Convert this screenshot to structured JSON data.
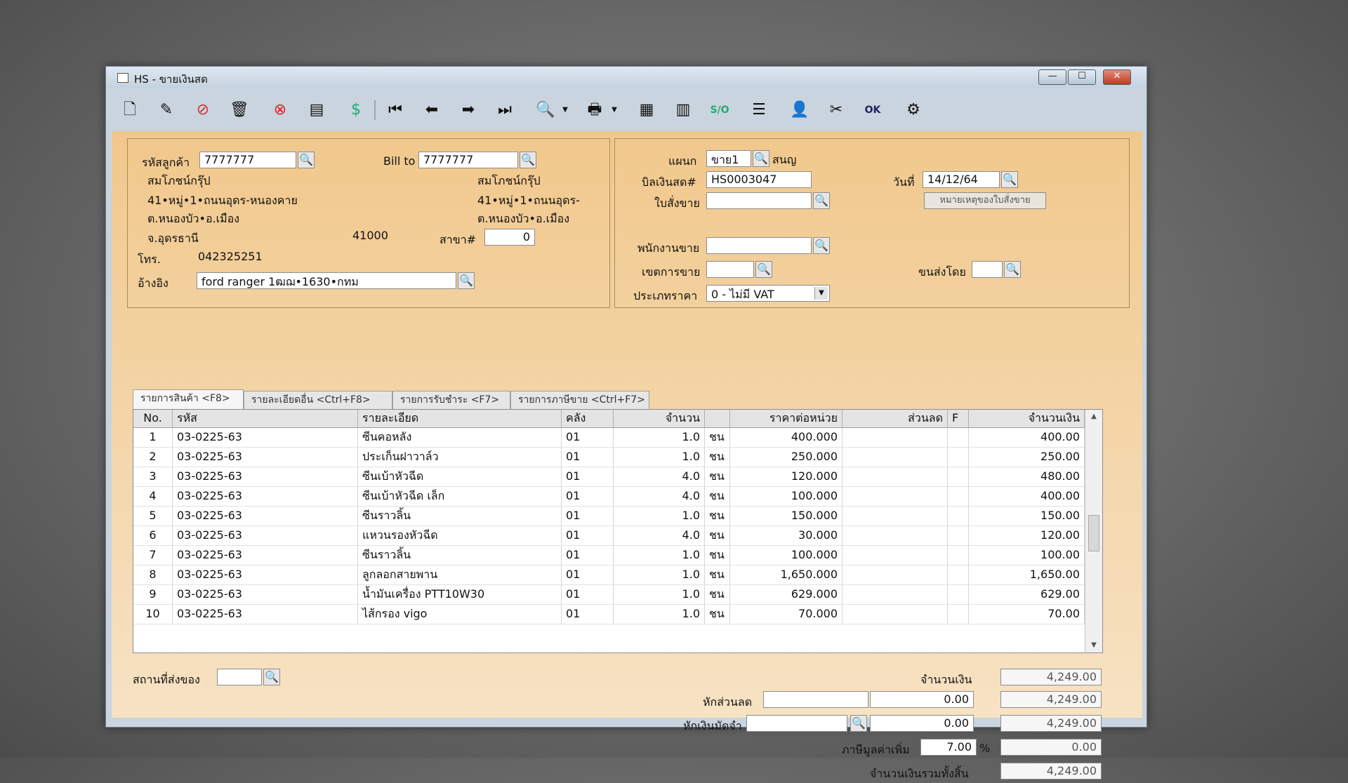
{
  "window": {
    "title": "HS - ขายเงินสด",
    "min": "—",
    "max": "☐",
    "close": "✕"
  },
  "toolbar_icons": [
    "new-document-icon",
    "edit-icon",
    "void-icon",
    "delete-bin-icon",
    "cancel-icon",
    "save-icon",
    "money-icon",
    "first-record-icon",
    "previous-record-icon",
    "next-record-icon",
    "last-record-icon",
    "search-icon",
    "print-icon",
    "calculator-icon",
    "report-icon",
    "svg-export-icon",
    "list-icon",
    "approve-user-icon",
    "tools-icon",
    "ok-icon",
    "settings-icon"
  ],
  "customer": {
    "code_label": "รหัสลูกค้า",
    "code": "7777777",
    "name": "สมโภชน์กรุ๊ป",
    "addr1": "41•หมู่•1•ถนนอุดร-หนองคาย",
    "addr2": "ต.หนองบัว•อ.เมือง",
    "addr3": "จ.อุดรธานี",
    "zip": "41000",
    "phone_label": "โทร.",
    "phone": "042325251",
    "ref_label": "อ้างอิง",
    "ref": "ford ranger 1ฒฌ•1630•กทม"
  },
  "billto": {
    "label": "Bill to",
    "code": "7777777",
    "name": "สมโภชน์กรุ๊ป",
    "addr1": "41•หมู่•1•ถนนอุดร-",
    "addr2": "ต.หนองบัว•อ.เมือง",
    "branch_label": "สาขา#",
    "branch": "0"
  },
  "doc": {
    "dept_label": "แผนก",
    "dept": "ขาย1",
    "dept_name": "สนญ",
    "bill_label": "บิลเงินสด#",
    "bill": "HS0003047",
    "date_label": "วันที่",
    "date": "14/12/64",
    "so_label": "ใบสั่งขาย",
    "so": "",
    "so_note_button": "หมายเหตุของใบสั่งขาย",
    "salesman_label": "พนักงานขาย",
    "salesman": "",
    "zone_label": "เขตการขาย",
    "zone": "",
    "ship_by_label": "ขนส่งโดย",
    "ship_by": "",
    "price_type_label": "ประเภทราคา",
    "price_type": "0 - ไม่มี VAT"
  },
  "tabs": [
    "รายการสินค้า <F8>",
    "รายละเอียดอื่น <Ctrl+F8>",
    "รายการรับชำระ <F7>",
    "รายการภาษีขาย <Ctrl+F7>"
  ],
  "columns": {
    "no": "No.",
    "code": "รหัส",
    "desc": "รายละเอียด",
    "wh": "คลัง",
    "qty": "จำนวน",
    "price": "ราคาต่อหน่วย",
    "disc": "ส่วนลด",
    "f": "F",
    "amount": "จำนวนเงิน"
  },
  "items": [
    {
      "no": "1",
      "code": "03-0225-63",
      "desc": "ซีนคอหลัง",
      "wh": "01",
      "qty": "1.0",
      "unit": "ชน",
      "price": "400.000",
      "disc": "",
      "f": "",
      "amount": "400.00"
    },
    {
      "no": "2",
      "code": "03-0225-63",
      "desc": "ประเก็นฝาวาล์ว",
      "wh": "01",
      "qty": "1.0",
      "unit": "ชน",
      "price": "250.000",
      "disc": "",
      "f": "",
      "amount": "250.00"
    },
    {
      "no": "3",
      "code": "03-0225-63",
      "desc": "ซีนเบ้าหัวฉีด",
      "wh": "01",
      "qty": "4.0",
      "unit": "ชน",
      "price": "120.000",
      "disc": "",
      "f": "",
      "amount": "480.00"
    },
    {
      "no": "4",
      "code": "03-0225-63",
      "desc": "ซีนเบ้าหัวฉีด เล็ก",
      "wh": "01",
      "qty": "4.0",
      "unit": "ชน",
      "price": "100.000",
      "disc": "",
      "f": "",
      "amount": "400.00"
    },
    {
      "no": "5",
      "code": "03-0225-63",
      "desc": "ซีนราวลิ้น",
      "wh": "01",
      "qty": "1.0",
      "unit": "ชน",
      "price": "150.000",
      "disc": "",
      "f": "",
      "amount": "150.00"
    },
    {
      "no": "6",
      "code": "03-0225-63",
      "desc": "แหวนรองหัวฉีด",
      "wh": "01",
      "qty": "4.0",
      "unit": "ชน",
      "price": "30.000",
      "disc": "",
      "f": "",
      "amount": "120.00"
    },
    {
      "no": "7",
      "code": "03-0225-63",
      "desc": "ซีนราวลิ้น",
      "wh": "01",
      "qty": "1.0",
      "unit": "ชน",
      "price": "100.000",
      "disc": "",
      "f": "",
      "amount": "100.00"
    },
    {
      "no": "8",
      "code": "03-0225-63",
      "desc": "ลูกลอกสายพาน",
      "wh": "01",
      "qty": "1.0",
      "unit": "ชน",
      "price": "1,650.000",
      "disc": "",
      "f": "",
      "amount": "1,650.00"
    },
    {
      "no": "9",
      "code": "03-0225-63",
      "desc": "น้ำมันเครื่อง PTT10W30",
      "wh": "01",
      "qty": "1.0",
      "unit": "ชน",
      "price": "629.000",
      "disc": "",
      "f": "",
      "amount": "629.00"
    },
    {
      "no": "10",
      "code": "03-0225-63",
      "desc": "ไส้กรอง vigo",
      "wh": "01",
      "qty": "1.0",
      "unit": "ชน",
      "price": "70.000",
      "disc": "",
      "f": "",
      "amount": "70.00"
    }
  ],
  "footer": {
    "ship_place_label": "สถานที่ส่งของ",
    "ship_place": "",
    "subtotal_label": "จำนวนเงิน",
    "subtotal": "4,249.00",
    "discount_label": "หักส่วนลด",
    "discount_text": "",
    "discount": "0.00",
    "after_discount": "4,249.00",
    "deposit_label": "หักเงินมัดจำ",
    "deposit_text": "",
    "deposit": "0.00",
    "after_deposit": "4,249.00",
    "vat_label": "ภาษีมูลค่าเพิ่ม",
    "vat_rate": "7.00",
    "vat_pct": "%",
    "vat": "0.00",
    "total_label": "จำนวนเงินรวมทั้งสิ้น",
    "total": "4,249.00"
  }
}
